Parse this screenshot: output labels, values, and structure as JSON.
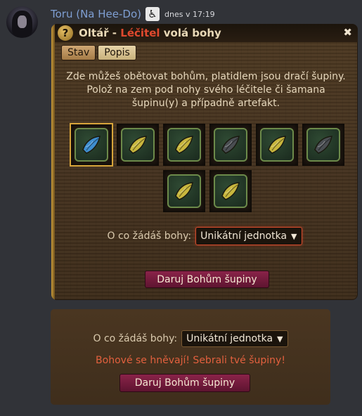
{
  "message": {
    "username": "Toru (Na Hee-Do)",
    "timestamp": "dnes v 17:19"
  },
  "window": {
    "title_prefix": "Oltář - ",
    "title_highlight": "Léčitel",
    "title_suffix": " volá bohy",
    "help_label": "?",
    "close_label": "✖",
    "tabs": [
      {
        "label": "Stav"
      },
      {
        "label": "Popis"
      }
    ],
    "intro": "Zde můžeš obětovat bohům, platidlem jsou dračí šupiny. Polož na zem pod nohy svého léčitele či šamana šupinu(y) a případně artefakt.",
    "scales": [
      {
        "color": "blue"
      },
      {
        "color": "yellow"
      },
      {
        "color": "yellow"
      },
      {
        "color": "dark"
      },
      {
        "color": "yellow"
      },
      {
        "color": "dark"
      },
      {
        "color": "yellow"
      },
      {
        "color": "yellow"
      }
    ],
    "request_label": "O co žádáš bohy:",
    "request_value": "Unikátní jednotka",
    "give_button": "Daruj Bohům šupiny"
  },
  "result": {
    "request_label": "O co žádáš bohy:",
    "request_value": "Unikátní jednotka",
    "error": "Bohové se hněvají! Sebrali tvé šupiny!",
    "give_button": "Daruj Bohům šupiny"
  },
  "colors": {
    "blue": "#3f8fd0",
    "yellow": "#c9b73e",
    "dark": "#4a4e52"
  }
}
